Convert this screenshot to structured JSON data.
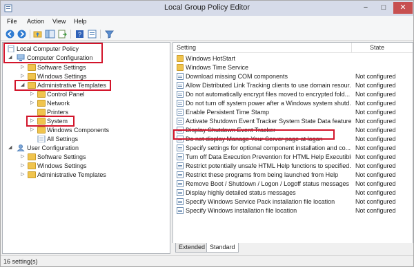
{
  "window": {
    "title": "Local Group Policy Editor",
    "controls": {
      "minimize": "−",
      "maximize": "□",
      "close": "✕"
    }
  },
  "menu": [
    "File",
    "Action",
    "View",
    "Help"
  ],
  "toolbar": {
    "buttons": [
      "back-icon",
      "forward-icon",
      "up-folder-icon",
      "show-hide-tree-icon",
      "export-list-icon",
      "help-icon",
      "properties-icon",
      "filter-icon"
    ]
  },
  "tree": {
    "root": "Local Computer Policy",
    "computer_config": "Computer Configuration",
    "software_settings": "Software Settings",
    "windows_settings": "Windows Settings",
    "admin_templates": "Administrative Templates",
    "control_panel": "Control Panel",
    "network": "Network",
    "printers": "Printers",
    "system": "System",
    "windows_components": "Windows Components",
    "all_settings": "All Settings",
    "user_config": "User Configuration",
    "user_software_settings": "Software Settings",
    "user_windows_settings": "Windows Settings",
    "user_admin_templates": "Administrative Templates"
  },
  "list": {
    "columns": {
      "setting": "Setting",
      "state": "State"
    },
    "rows": [
      {
        "name": "Windows HotStart",
        "state": "",
        "type": "folder"
      },
      {
        "name": "Windows Time Service",
        "state": "",
        "type": "folder"
      },
      {
        "name": "Download missing COM components",
        "state": "Not configured",
        "type": "setting"
      },
      {
        "name": "Allow Distributed Link Tracking clients to use domain resour...",
        "state": "Not configured",
        "type": "setting"
      },
      {
        "name": "Do not automatically encrypt files moved to encrypted fold...",
        "state": "Not configured",
        "type": "setting"
      },
      {
        "name": "Do not turn off system power after a Windows system shutd...",
        "state": "Not configured",
        "type": "setting"
      },
      {
        "name": "Enable Persistent Time Stamp",
        "state": "Not configured",
        "type": "setting"
      },
      {
        "name": "Activate Shutdown Event Tracker System State Data feature",
        "state": "Not configured",
        "type": "setting"
      },
      {
        "name": "Display Shutdown Event Tracker",
        "state": "Not configured",
        "type": "setting"
      },
      {
        "name": "Do not display Manage Your Server page at logon",
        "state": "Not configured",
        "type": "setting"
      },
      {
        "name": "Specify settings for optional component installation and co...",
        "state": "Not configured",
        "type": "setting"
      },
      {
        "name": "Turn off Data Execution Prevention for HTML Help Executible",
        "state": "Not configured",
        "type": "setting"
      },
      {
        "name": "Restrict potentially unsafe HTML Help functions to specified...",
        "state": "Not configured",
        "type": "setting"
      },
      {
        "name": "Restrict these programs from being launched from Help",
        "state": "Not configured",
        "type": "setting"
      },
      {
        "name": "Remove Boot / Shutdown / Logon / Logoff status messages",
        "state": "Not configured",
        "type": "setting"
      },
      {
        "name": "Display highly detailed status messages",
        "state": "Not configured",
        "type": "setting"
      },
      {
        "name": "Specify Windows Service Pack installation file location",
        "state": "Not configured",
        "type": "setting"
      },
      {
        "name": "Specify Windows installation file location",
        "state": "Not configured",
        "type": "setting"
      }
    ]
  },
  "tabs": {
    "extended": "Extended",
    "standard": "Standard"
  },
  "status": "16 setting(s)",
  "colors": {
    "highlight": "#d2142a",
    "folder": "#f0c44e",
    "titlebar": "#d6dbe9"
  }
}
